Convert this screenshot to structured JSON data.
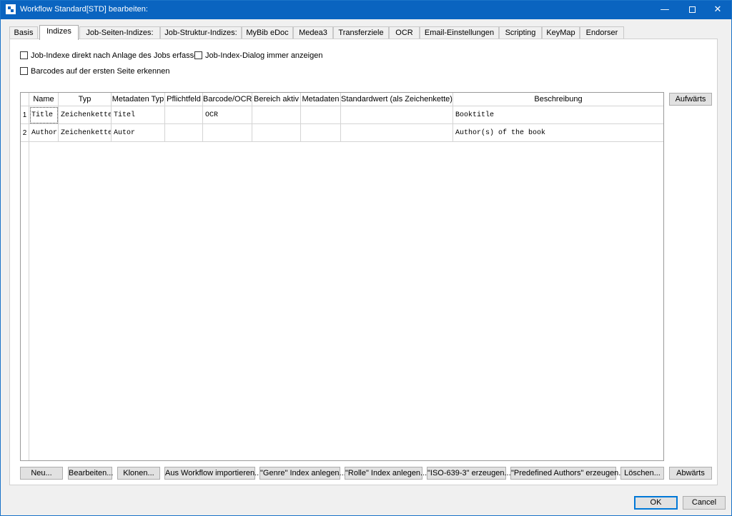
{
  "window": {
    "title": "Workflow Standard[STD] bearbeiten:",
    "minimize": "—",
    "close": "✕"
  },
  "tabs": [
    "Basis",
    "Indizes",
    "Job-Seiten-Indizes:",
    "Job-Struktur-Indizes:",
    "MyBib eDoc",
    "Medea3",
    "Transferziele",
    "OCR",
    "Email-Einstellungen",
    "Scripting",
    "KeyMap",
    "Endorser"
  ],
  "active_tab": "Indizes",
  "options": {
    "job_index_on_create": {
      "label": "Job-Indexe direkt nach Anlage des Jobs erfassen",
      "checked": false
    },
    "always_show_dialog": {
      "label": "Job-Index-Dialog immer anzeigen",
      "checked": false
    },
    "barcodes_first_page": {
      "label": "Barcodes auf der ersten Seite erkennen",
      "checked": false
    }
  },
  "table": {
    "columns": [
      "Name",
      "Typ",
      "Metadaten Typ",
      "Pflichtfeld",
      "Barcode/OCR",
      "Bereich aktiv",
      "Metadaten",
      "Standardwert (als Zeichenkette)",
      "Beschreibung"
    ],
    "rows": [
      {
        "num": "1",
        "cells": [
          "Title",
          "Zeichenkette",
          "Titel",
          "",
          "OCR",
          "",
          "",
          "",
          "Booktitle"
        ]
      },
      {
        "num": "2",
        "cells": [
          "Author",
          "Zeichenkette",
          "Autor",
          "",
          "",
          "",
          "",
          "",
          "Author(s) of the book"
        ]
      }
    ]
  },
  "side_buttons": {
    "up": "Aufwärts",
    "down": "Abwärts"
  },
  "bottom_buttons": {
    "new": "Neu...",
    "edit": "Bearbeiten...",
    "clone": "Klonen...",
    "import": "Aus Workflow importieren...",
    "genre": "\"Genre\" Index anlegen...",
    "rolle": "\"Rolle\" Index anlegen...",
    "iso": "\"ISO-639-3\" erzeugen...",
    "authors": "\"Predefined Authors\" erzeugen...",
    "delete": "Löschen..."
  },
  "dialog_buttons": {
    "ok": "OK",
    "cancel": "Cancel"
  }
}
